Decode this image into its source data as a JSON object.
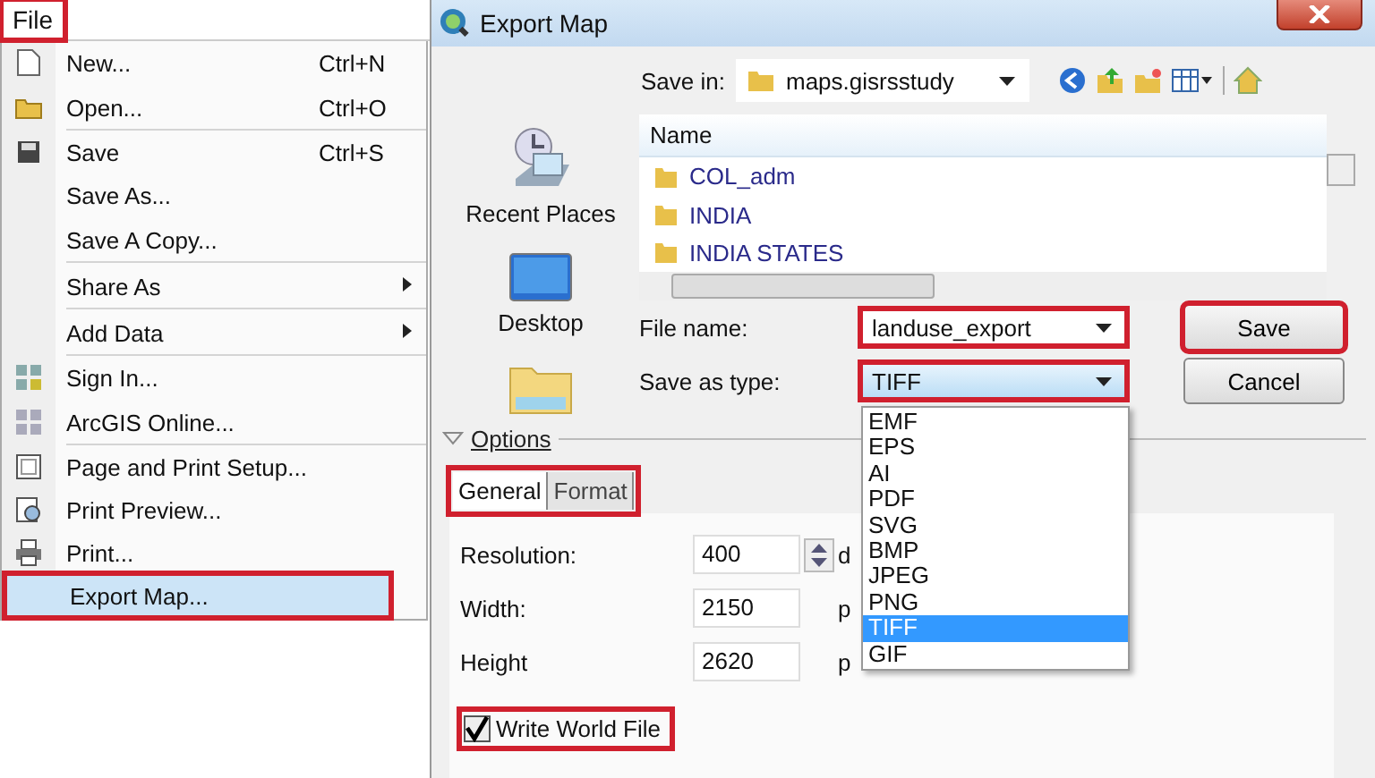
{
  "menu_bar": {
    "title": "File",
    "highlighted": true
  },
  "file_menu": {
    "items": [
      {
        "label": "New...",
        "shortcut": "Ctrl+N",
        "submenu": false,
        "separator_after": false,
        "selected": false,
        "highlighted": false
      },
      {
        "label": "Open...",
        "shortcut": "Ctrl+O",
        "submenu": false,
        "separator_after": true,
        "selected": false,
        "highlighted": false
      },
      {
        "label": "Save",
        "shortcut": "Ctrl+S",
        "submenu": false,
        "separator_after": false,
        "selected": false,
        "highlighted": false
      },
      {
        "label": "Save As...",
        "submenu": false,
        "separator_after": false,
        "selected": false,
        "highlighted": false
      },
      {
        "label": "Save A Copy...",
        "submenu": false,
        "separator_after": true,
        "selected": false,
        "highlighted": false
      },
      {
        "label": "Share As",
        "submenu": true,
        "separator_after": true,
        "selected": false,
        "highlighted": false
      },
      {
        "label": "Add Data",
        "submenu": true,
        "separator_after": true,
        "selected": false,
        "highlighted": false
      },
      {
        "label": "Sign In...",
        "submenu": false,
        "separator_after": false,
        "selected": false,
        "highlighted": false
      },
      {
        "label": "ArcGIS Online...",
        "submenu": false,
        "separator_after": true,
        "selected": false,
        "highlighted": false
      },
      {
        "label": "Page and Print Setup...",
        "submenu": false,
        "separator_after": false,
        "selected": false,
        "highlighted": false
      },
      {
        "label": "Print Preview...",
        "submenu": false,
        "separator_after": false,
        "selected": false,
        "highlighted": false
      },
      {
        "label": "Print...",
        "submenu": false,
        "separator_after": false,
        "selected": false,
        "highlighted": false
      },
      {
        "label": "Export Map...",
        "submenu": false,
        "separator_after": false,
        "selected": true,
        "highlighted": true
      }
    ]
  },
  "dialog": {
    "title": "Export Map",
    "save_in": {
      "label": "Save in:",
      "value": "maps.gisrsstudy"
    },
    "places": [
      {
        "label": "Recent Places"
      },
      {
        "label": "Desktop"
      }
    ],
    "file_list": {
      "header": "Name",
      "rows": [
        "COL_adm",
        "INDIA",
        "INDIA STATES"
      ]
    },
    "file_name": {
      "label": "File name:",
      "value": "landuse_export",
      "highlighted": true
    },
    "save_as_type": {
      "label": "Save as type:",
      "value": "TIFF",
      "highlighted": true,
      "expanded": true,
      "options": [
        {
          "label": "EMF",
          "selected": false
        },
        {
          "label": "EPS",
          "selected": false
        },
        {
          "label": "AI",
          "selected": false
        },
        {
          "label": "PDF",
          "selected": false
        },
        {
          "label": "SVG",
          "selected": false
        },
        {
          "label": "BMP",
          "selected": false
        },
        {
          "label": "JPEG",
          "selected": false
        },
        {
          "label": "PNG",
          "selected": false
        },
        {
          "label": "TIFF",
          "selected": true
        },
        {
          "label": "GIF",
          "selected": false
        }
      ]
    },
    "buttons": [
      {
        "label": "Save",
        "highlighted": true
      },
      {
        "label": "Cancel",
        "highlighted": false
      }
    ],
    "options": {
      "label": "Options",
      "expanded": true,
      "tabs": [
        {
          "label": "General",
          "selected": true
        },
        {
          "label": "Format",
          "selected": false
        }
      ],
      "tabs_highlighted": true,
      "fields": [
        {
          "label": "Resolution:",
          "value": "400",
          "unit": "d",
          "spinner": true
        },
        {
          "label": "Width:",
          "value": "2150",
          "unit": "p",
          "spinner": false
        },
        {
          "label": "Height",
          "value": "2620",
          "unit": "p",
          "spinner": false
        }
      ],
      "checkbox": {
        "label": "Write World File",
        "checked": true,
        "highlighted": true
      }
    }
  }
}
